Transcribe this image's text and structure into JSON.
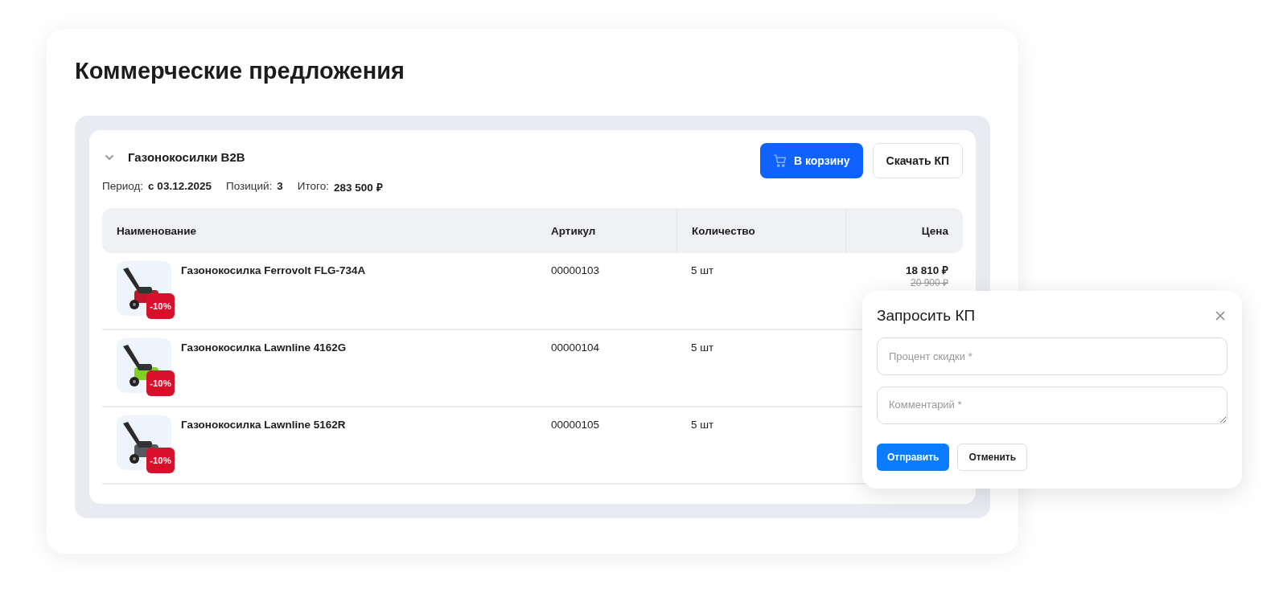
{
  "page_title": "Коммерческие предложения",
  "offer": {
    "title": "Газонокосилки B2B",
    "expanded": true,
    "summary": [
      {
        "label": "Период:",
        "value": "с 03.12.2025"
      },
      {
        "label": "Позиций:",
        "value": "3"
      },
      {
        "label": "Итого:",
        "value": "283 500 ₽"
      }
    ],
    "buttons": [
      {
        "kind": "primary",
        "label": "В корзину"
      },
      {
        "kind": "secondary",
        "label": "Скачать КП"
      }
    ],
    "table": {
      "columns": [
        "Наименование",
        "Артикул",
        "Количество",
        "Цена"
      ],
      "rows": [
        {
          "name": "Газонокосилка Ferrovolt FLG-734A",
          "article": "00000103",
          "quantity": "5 шт",
          "badge": "-10%",
          "price": "18 810 ₽",
          "old_price": "20 900 ₽"
        },
        {
          "name": "Газонокосилка Lawnline 4162G",
          "article": "00000104",
          "quantity": "5 шт",
          "badge": "-10%"
        },
        {
          "name": "Газонокосилка Lawnline 5162R",
          "article": "00000105",
          "quantity": "5 шт",
          "badge": "-10%"
        }
      ]
    }
  },
  "dialog": {
    "title": "Запросить КП",
    "fields": [
      {
        "kind": "input",
        "placeholder": "Процент скидки *"
      },
      {
        "kind": "textarea",
        "placeholder": "Комментарий *"
      }
    ],
    "buttons": [
      {
        "kind": "primary",
        "label": "Отправить"
      },
      {
        "kind": "secondary",
        "label": "Отменить"
      }
    ]
  }
}
